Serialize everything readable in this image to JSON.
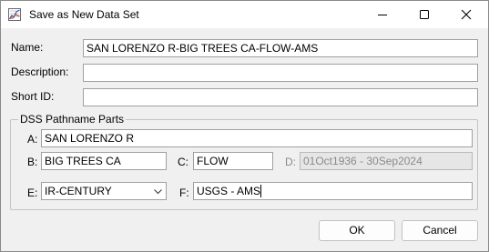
{
  "window": {
    "title": "Save as New Data Set"
  },
  "form": {
    "name_label": "Name:",
    "name_value": "SAN LORENZO R-BIG TREES CA-FLOW-AMS",
    "description_label": "Description:",
    "description_value": "",
    "shortid_label": "Short ID:",
    "shortid_value": ""
  },
  "dss": {
    "group_title": "DSS Pathname Parts",
    "a_label": "A:",
    "a_value": "SAN LORENZO R",
    "b_label": "B:",
    "b_value": "BIG TREES CA",
    "c_label": "C:",
    "c_value": "FLOW",
    "d_label": "D:",
    "d_value": "01Oct1936 - 30Sep2024",
    "e_label": "E:",
    "e_value": "IR-CENTURY",
    "f_label": "F:",
    "f_value": "USGS - AMS"
  },
  "buttons": {
    "ok": "OK",
    "cancel": "Cancel"
  },
  "icons": {
    "app": "chart-icon",
    "minimize": "minimize-icon",
    "maximize": "maximize-icon",
    "close": "close-icon",
    "dropdown": "chevron-down-icon"
  }
}
